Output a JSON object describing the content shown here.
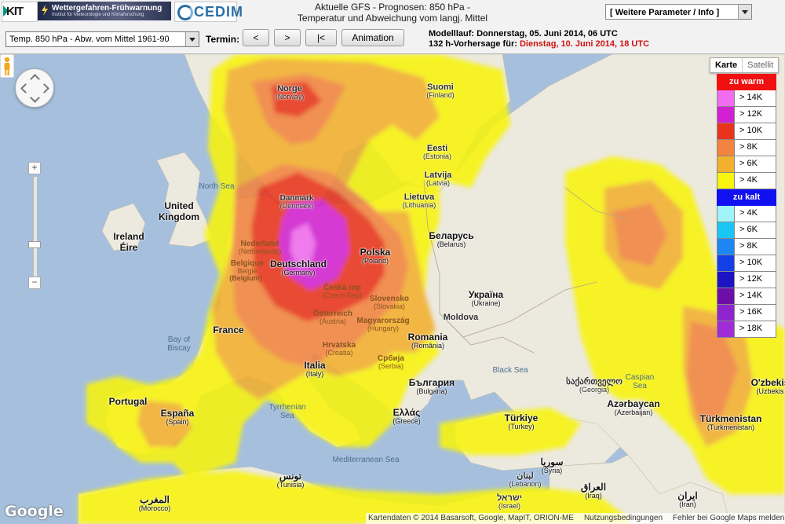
{
  "header": {
    "kit_logo": "KIT",
    "banner_title": "Wettergefahren-Frühwarnung",
    "banner_subtitle": "Institut für Meteorologie und Klimaforschung",
    "cedim_logo": "CEDIM",
    "title_line1": "Aktuelle GFS - Prognosen: 850 hPa -",
    "title_line2": "Temperatur und Abweichung vom langj. Mittel",
    "params_dropdown": "[ Weitere Parameter / Info ]"
  },
  "toolbar": {
    "parameter_select": "Temp. 850 hPa - Abw. vom Mittel 1961-90",
    "termin_label": "Termin:",
    "prev_button": "<",
    "next_button": ">",
    "first_button": "|<",
    "animation_button": "Animation",
    "modelllauf_label": "Modelllauf: Donnerstag, 05. Juni 2014, 06 UTC",
    "vorhersage_label": "132 h-Vorhersage für:",
    "vorhersage_value": "Dienstag, 10. Juni 2014, 18 UTC"
  },
  "map": {
    "type_buttons": [
      "Karte",
      "Satellit"
    ],
    "countries": [
      {
        "name": "Norge",
        "sub": "(Norway)"
      },
      {
        "name": "Suomi",
        "sub": "(Finland)"
      },
      {
        "name": "Eesti",
        "sub": "(Estonia)"
      },
      {
        "name": "Latvija",
        "sub": "(Latvia)"
      },
      {
        "name": "Lietuva",
        "sub": "(Lithuania)"
      },
      {
        "name": "Danmark",
        "sub": "(Denmark)"
      },
      {
        "name": "Nederland",
        "sub": "(Netherlands)"
      },
      {
        "name": "Belgique",
        "sub": "België"
      },
      {
        "name": "",
        "sub": "(Belgium)"
      },
      {
        "name": "Deutschland",
        "sub": "(Germany)"
      },
      {
        "name": "Polska",
        "sub": "(Poland)"
      },
      {
        "name": "Беларусь",
        "sub": "(Belarus)"
      },
      {
        "name": "Česká rep",
        "sub": "(Czech Rep)"
      },
      {
        "name": "Slovensko",
        "sub": "(Slovakia)"
      },
      {
        "name": "Україна",
        "sub": "(Ukraine)"
      },
      {
        "name": "Österreich",
        "sub": "(Austria)"
      },
      {
        "name": "Magyarország",
        "sub": "(Hungary)"
      },
      {
        "name": "Moldova",
        "sub": ""
      },
      {
        "name": "Hrvatska",
        "sub": "(Croatia)"
      },
      {
        "name": "Србија",
        "sub": "(Serbia)"
      },
      {
        "name": "Romania",
        "sub": "(România)"
      },
      {
        "name": "United",
        "sub": ""
      },
      {
        "name": "Kingdom",
        "sub": ""
      },
      {
        "name": "Ireland",
        "sub": ""
      },
      {
        "name": "Éire",
        "sub": ""
      },
      {
        "name": "France",
        "sub": ""
      },
      {
        "name": "Italia",
        "sub": "(Italy)"
      },
      {
        "name": "България",
        "sub": "(Bulgaria)"
      },
      {
        "name": "Portugal",
        "sub": ""
      },
      {
        "name": "España",
        "sub": "(Spain)"
      },
      {
        "name": "Ελλάς",
        "sub": "(Greece)"
      },
      {
        "name": "Türkiye",
        "sub": "(Turkey)"
      },
      {
        "name": "საქართველო",
        "sub": "(Georgia)"
      },
      {
        "name": "Azərbaycan",
        "sub": "(Azerbaijan)"
      },
      {
        "name": "Türkmenistan",
        "sub": "(Turkmenistan)"
      },
      {
        "name": "O'zbekis",
        "sub": "(Uzbekis"
      },
      {
        "name": "المغرب",
        "sub": "(Morocco)"
      },
      {
        "name": "تونس",
        "sub": "(Tunisia)"
      },
      {
        "name": "سوريا",
        "sub": "(Syria)"
      },
      {
        "name": "لبنان",
        "sub": "(Lebanon)"
      },
      {
        "name": "العراق",
        "sub": "(Iraq)"
      },
      {
        "name": "ايران",
        "sub": "(Iran)"
      },
      {
        "name": "ישראל",
        "sub": "(Israel)"
      }
    ],
    "seas": [
      "North Sea",
      "Bay of Biscay",
      "Tyrrhenian Sea",
      "Black Sea",
      "Caspian Sea",
      "Mediterranean Sea"
    ],
    "google_logo": "Google",
    "footer_attribution": "Kartendaten © 2014 Basarsoft, Google, MapIT, ORION-ME",
    "footer_terms": "Nutzungsbedingungen",
    "footer_report": "Fehler bei Google Maps melden"
  },
  "legend": {
    "warm_title": "zu warm",
    "warm_items": [
      {
        "label": "> 14K",
        "color": "#f06cf0"
      },
      {
        "label": "> 12K",
        "color": "#d220d2"
      },
      {
        "label": "> 10K",
        "color": "#e8341c"
      },
      {
        "label": "> 8K",
        "color": "#f28440"
      },
      {
        "label": "> 6K",
        "color": "#f2b02e"
      },
      {
        "label": "> 4K",
        "color": "#f8f40e"
      }
    ],
    "cold_title": "zu kalt",
    "cold_items": [
      {
        "label": "> 4K",
        "color": "#9ef4f6"
      },
      {
        "label": "> 6K",
        "color": "#1ac6f4"
      },
      {
        "label": "> 8K",
        "color": "#1e86f2"
      },
      {
        "label": "> 10K",
        "color": "#1240e6"
      },
      {
        "label": "> 12K",
        "color": "#1c14c2"
      },
      {
        "label": "> 14K",
        "color": "#6e0ea8"
      },
      {
        "label": "> 16K",
        "color": "#8e24cc"
      },
      {
        "label": "> 18K",
        "color": "#a02cd8"
      }
    ],
    "warm_header_color": "#f01010",
    "cold_header_color": "#1010f0"
  }
}
